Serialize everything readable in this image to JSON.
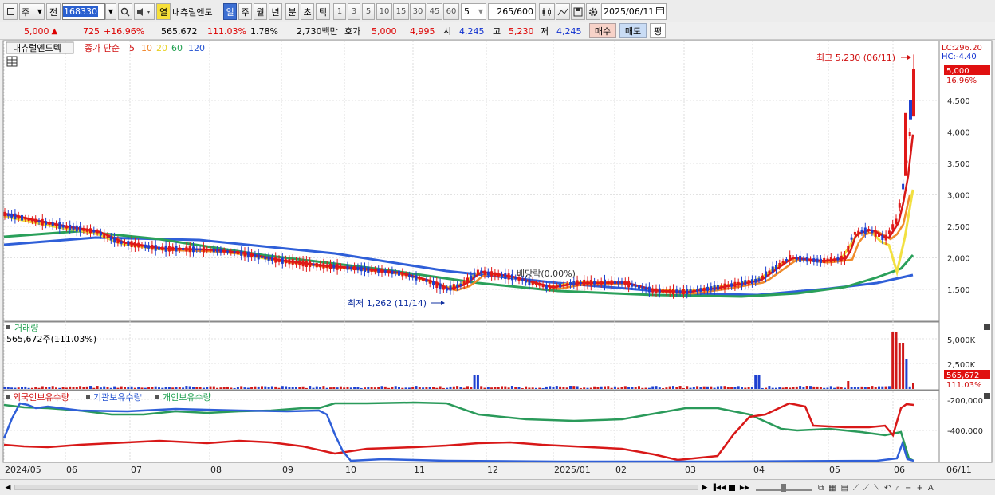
{
  "toolbar": {
    "market": "주",
    "prev_label": "전",
    "code": "168330",
    "open_label": "열",
    "name": "내츄럴엔도",
    "period_day": "일",
    "period_week": "주",
    "period_month": "월",
    "period_year": "년",
    "period_minute": "분",
    "period_second": "초",
    "period_tick": "틱",
    "intervals": [
      "1",
      "3",
      "5",
      "10",
      "15",
      "30",
      "45",
      "60"
    ],
    "interval_selected": "5",
    "count": "265",
    "count_total": "/600",
    "date": "2025/06/11"
  },
  "quote": {
    "price": "5,000",
    "change": "725",
    "change_pct": "+16.96%",
    "volume": "565,672",
    "volume_ratio": "111.03%",
    "turnover": "1.78%",
    "amount": "2,730백만",
    "hoga_label": "호가",
    "ask": "5,000",
    "bid": "4,995",
    "open_label": "시",
    "open": "4,245",
    "high_label": "고",
    "high": "5,230",
    "low_label": "저",
    "low": "4,245",
    "buy_label": "매수",
    "sell_label": "매도",
    "eval_label": "평"
  },
  "price_pane": {
    "stock_name": "내츄럴엔도텍",
    "legend_title": "종가 단순",
    "ma_labels": [
      "5",
      "10",
      "20",
      "60",
      "120"
    ],
    "ma_colors": [
      "#d01010",
      "#f08020",
      "#f0e020",
      "#20a050",
      "#2050d0"
    ],
    "y_ticks": [
      "4,500",
      "4,000",
      "3,500",
      "3,000",
      "2,500",
      "2,000",
      "1,500"
    ],
    "lc": "LC:296.20",
    "hc": "HC:-4.40",
    "cur_price": "5,000",
    "cur_pct": "16.96%",
    "high_note": "최고 5,230 (06/11)",
    "low_note": "최저 1,262 (11/14)",
    "dividend_note": "배당락(0.00%)"
  },
  "volume_pane": {
    "title": "거래량",
    "sub": "565,672주(111.03%)",
    "y_ticks": [
      "5,000K",
      "2,500K"
    ],
    "cur": "565,672",
    "cur_pct": "111.03%"
  },
  "holding_pane": {
    "legend": [
      "외국인보유수량",
      "기관보유수량",
      "개인보유수량"
    ],
    "colors": [
      "#d01010",
      "#2050d0",
      "#20a050"
    ],
    "y_ticks": [
      "-200,000",
      "-400,000"
    ]
  },
  "x_axis": {
    "labels": [
      "2024/05",
      "06",
      "07",
      "08",
      "09",
      "10",
      "11",
      "12",
      "2025/01",
      "02",
      "03",
      "04",
      "05",
      "06"
    ],
    "right_label": "06/11"
  }
}
